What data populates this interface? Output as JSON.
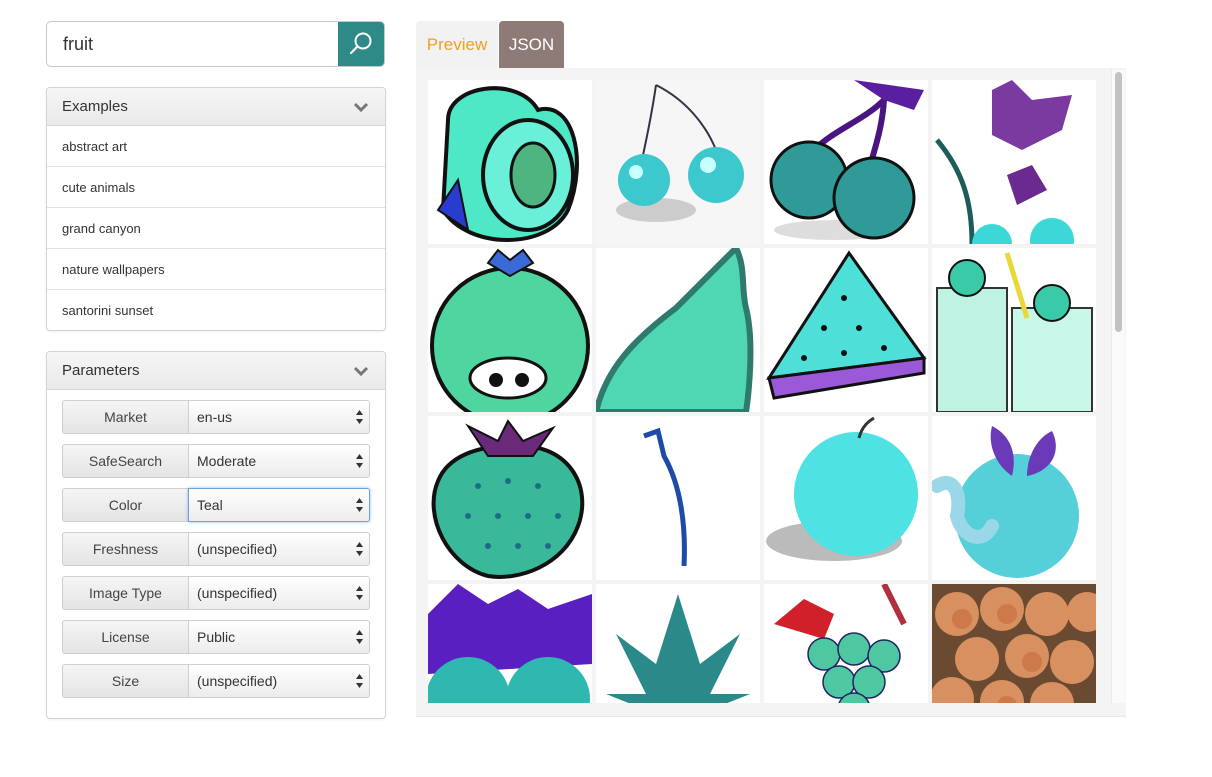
{
  "search": {
    "query": "fruit",
    "button_icon": "search-icon",
    "accent": "#2e8a86"
  },
  "examples": {
    "title": "Examples",
    "items": [
      "abstract art",
      "cute animals",
      "grand canyon",
      "nature wallpapers",
      "santorini sunset"
    ]
  },
  "parameters": {
    "title": "Parameters",
    "rows": [
      {
        "label": "Market",
        "value": "en-us"
      },
      {
        "label": "SafeSearch",
        "value": "Moderate"
      },
      {
        "label": "Color",
        "value": "Teal"
      },
      {
        "label": "Freshness",
        "value": "(unspecified)"
      },
      {
        "label": "Image Type",
        "value": "(unspecified)"
      },
      {
        "label": "License",
        "value": "Public"
      },
      {
        "label": "Size",
        "value": "(unspecified)"
      }
    ]
  },
  "tabs": {
    "preview": "Preview",
    "json": "JSON",
    "active": "preview"
  },
  "results": {
    "images": [
      "peach",
      "cherries-glossy",
      "cherries-dark",
      "cherry-branch-leaves",
      "blueberry-face",
      "pear",
      "watermelon-slice",
      "strawberry-smoothie",
      "strawberry",
      "stem",
      "apple-shaded",
      "apple-worm",
      "blackberries-leaves",
      "pineapple-top",
      "grapes",
      "peaches-photo"
    ]
  },
  "colors": {
    "tab_preview_text": "#f0a020",
    "tab_json_bg": "#8e7b78",
    "teal": "#55e0c8"
  }
}
